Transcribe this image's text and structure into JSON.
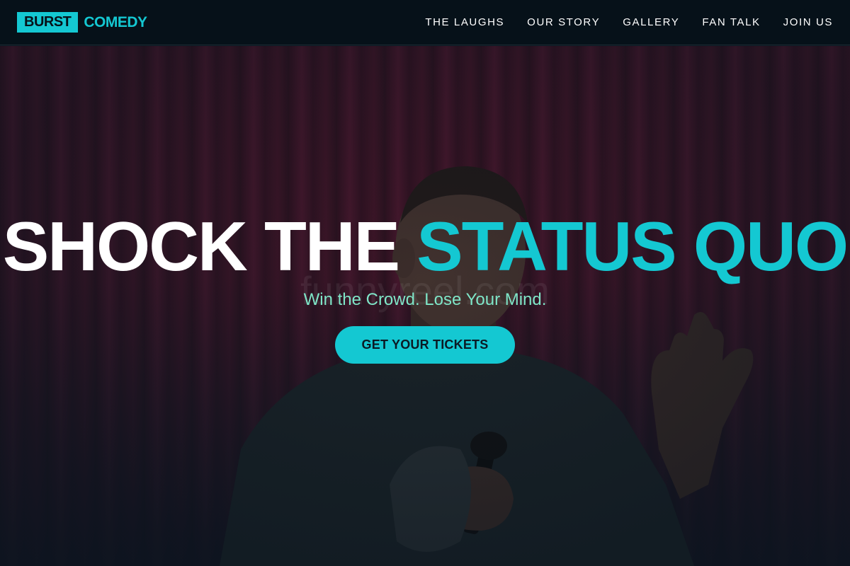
{
  "brand": {
    "box": "BURST",
    "text": "COMEDY",
    "accent": "#14c8d2"
  },
  "nav": {
    "items": [
      {
        "label": "THE LAUGHS"
      },
      {
        "label": "OUR STORY"
      },
      {
        "label": "GALLERY"
      },
      {
        "label": "FAN TALK"
      },
      {
        "label": "JOIN US"
      }
    ]
  },
  "hero": {
    "headline_white": "SHOCK THE",
    "headline_accent": "STATUS QUO",
    "subtitle": "Win the Crowd. Lose Your Mind.",
    "cta": "GET YOUR TICKETS",
    "watermark": "funnyreel.com",
    "image": "comedian-on-stage-with-microphone"
  },
  "colors": {
    "header_bg": "#061119",
    "accent": "#14c8d2",
    "subtitle": "#7fe6c8",
    "curtain": "#5a1730"
  }
}
